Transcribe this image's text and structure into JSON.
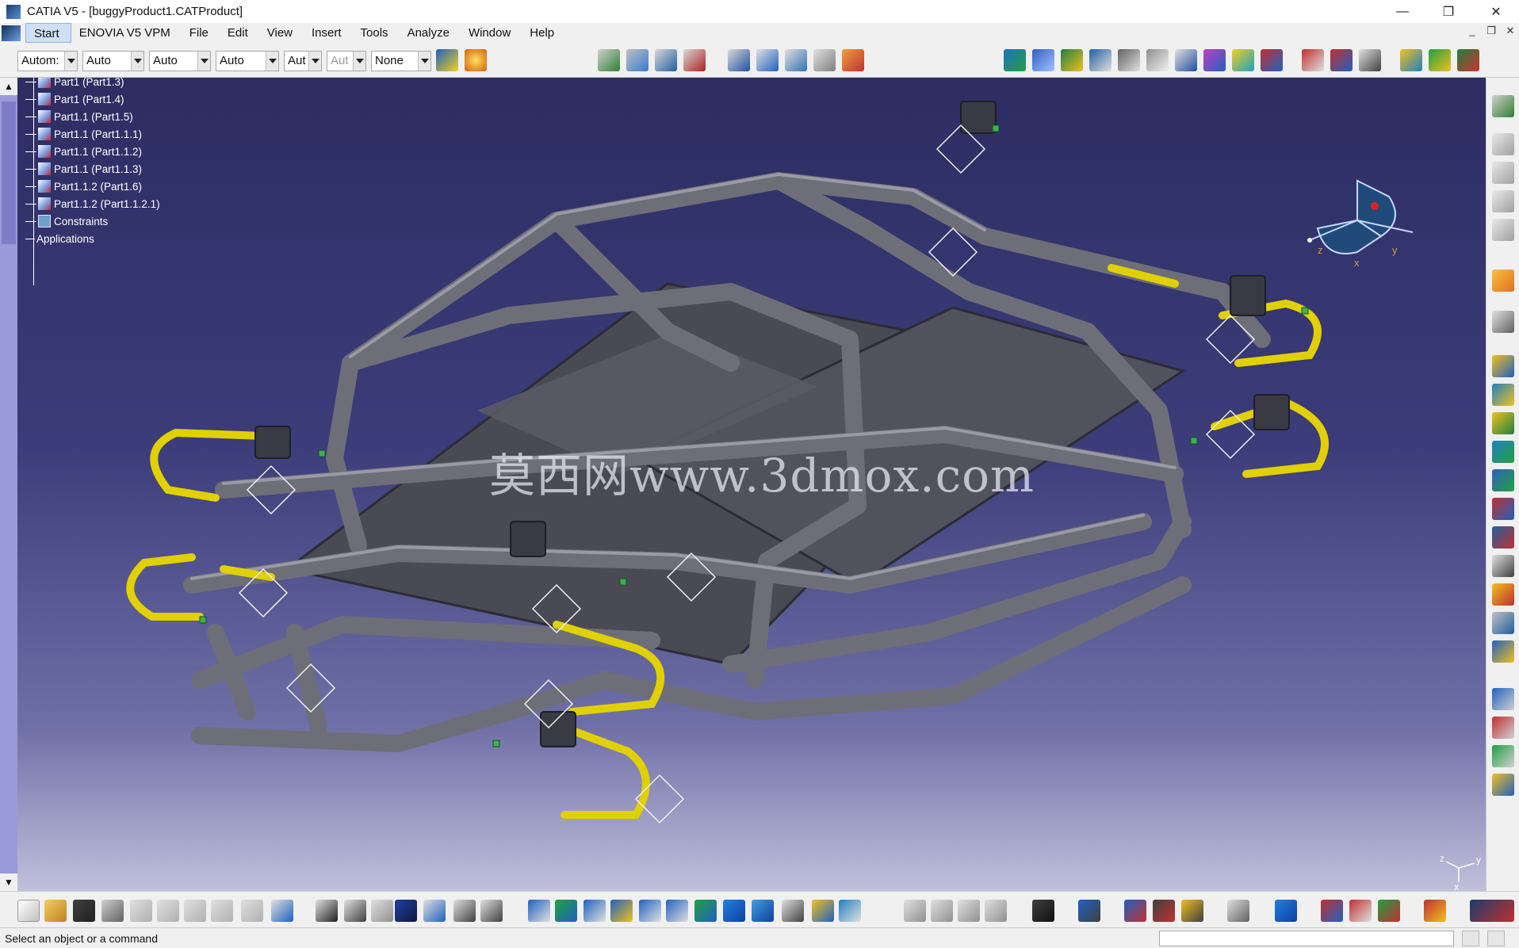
{
  "window": {
    "title": "CATIA V5 - [buggyProduct1.CATProduct]",
    "minimize": "—",
    "restore": "❐",
    "close": "✕"
  },
  "menu": {
    "items": [
      "Start",
      "ENOVIA V5 VPM",
      "File",
      "Edit",
      "View",
      "Insert",
      "Tools",
      "Analyze",
      "Window",
      "Help"
    ],
    "mdi_minimize": "_",
    "mdi_restore": "❐",
    "mdi_close": "✕"
  },
  "toolbar": {
    "combos": [
      "Autom:",
      "Auto",
      "Auto",
      "Auto",
      "Aut",
      "Aut",
      "None"
    ]
  },
  "tree": {
    "nodes": [
      "Part1 (Part1.3)",
      "Part1 (Part1.4)",
      "Part1.1 (Part1.5)",
      "Part1.1 (Part1.1.1)",
      "Part1.1 (Part1.1.2)",
      "Part1.1 (Part1.1.3)",
      "Part1.1.2 (Part1.6)",
      "Part1.1.2 (Part1.1.2.1)",
      "Constraints",
      "Applications"
    ]
  },
  "watermark": "莫西网www.3dmox.com",
  "compass": {
    "x": "x",
    "y": "y",
    "z": "z"
  },
  "mini_axis": {
    "x": "x",
    "y": "y",
    "z": "z"
  },
  "status": {
    "message": "Select an object or a command"
  },
  "colors": {
    "viewport_top": "#2d2d63",
    "viewport_bottom": "#c0c0dc",
    "tube": "#6e6e78",
    "hoop_yellow": "#e0d000",
    "plate": "#4a4a55"
  }
}
